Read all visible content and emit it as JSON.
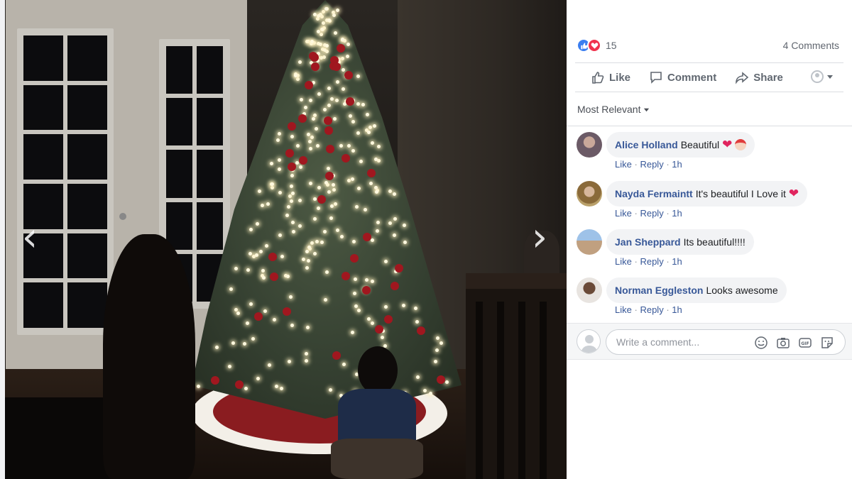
{
  "photo": {
    "prev_arrow": "‹",
    "next_arrow": "›"
  },
  "reactions": {
    "count": "15",
    "types": [
      "like-icon",
      "love-icon"
    ],
    "comments_count": "4 Comments"
  },
  "actions": {
    "like": "Like",
    "comment": "Comment",
    "share": "Share"
  },
  "sort": {
    "label": "Most Relevant"
  },
  "comments": [
    {
      "author": "Alice Holland",
      "text": "Beautiful",
      "like": "Like",
      "reply": "Reply",
      "time": "1h"
    },
    {
      "author": "Nayda Fermaintt",
      "text": "It's beautiful I Love it",
      "like": "Like",
      "reply": "Reply",
      "time": "1h"
    },
    {
      "author": "Jan Sheppard",
      "text": "Its beautiful!!!!",
      "like": "Like",
      "reply": "Reply",
      "time": "1h"
    },
    {
      "author": "Norman Eggleston",
      "text": "Looks awesome",
      "like": "Like",
      "reply": "Reply",
      "time": "1h"
    }
  ],
  "composer": {
    "placeholder": "Write a comment..."
  },
  "colors": {
    "link": "#385898",
    "like_blue": "#3b7ef0",
    "love_red": "#f0334d",
    "bubble_bg": "#f2f3f5"
  }
}
